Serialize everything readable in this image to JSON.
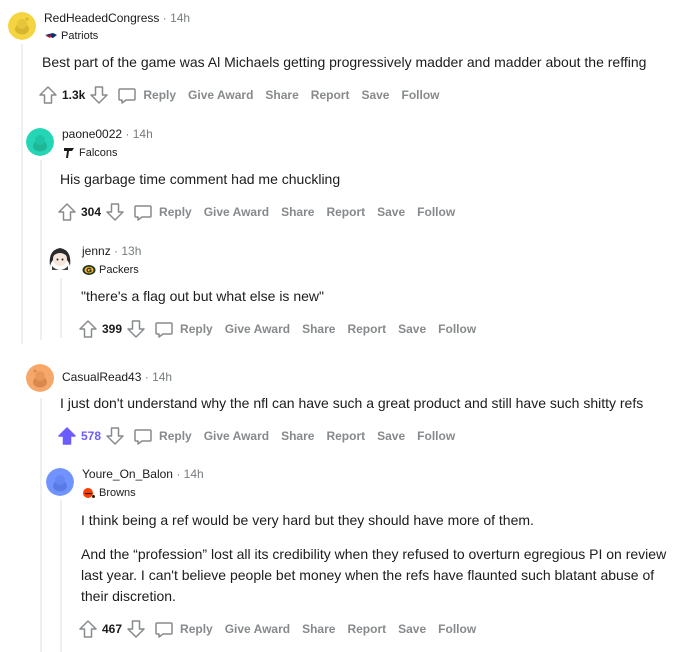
{
  "comments": [
    {
      "author": "RedHeadedCongress",
      "time": "· 14h",
      "flair": "Patriots",
      "body": "Best part of the game was Al Michaels getting progressively madder and madder about the reffing",
      "score": "1.3k",
      "avatar_color": "#f5d442"
    },
    {
      "author": "paone0022",
      "time": "· 14h",
      "flair": "Falcons",
      "body": "His garbage time comment had me chuckling",
      "score": "304",
      "avatar_color": "#24d6b5"
    },
    {
      "author": "jennz",
      "time": "· 13h",
      "flair": "Packers",
      "body": "\"there's a flag out but what else is new\"",
      "score": "399",
      "avatar_color": "#ffffff"
    },
    {
      "author": "CasualRead43",
      "time": "· 14h",
      "flair": "",
      "body": "I just don't understand why the nfl can have such a great product and still have such shitty refs",
      "score": "578",
      "avatar_color": "#f6a86b"
    },
    {
      "author": "Youre_On_Balon",
      "time": "· 14h",
      "flair": "Browns",
      "body1": "I think being a ref would be very hard but they should have more of them.",
      "body2": "And the “profession” lost all its credibility when they refused to overturn egregious PI on review last year. I can't believe people bet money when the refs have flaunted such blatant abuse of their discretion.",
      "score": "467",
      "avatar_color": "#7193ff"
    }
  ],
  "actions": {
    "reply": "Reply",
    "give_award": "Give Award",
    "share": "Share",
    "report": "Report",
    "save": "Save",
    "follow": "Follow"
  },
  "colors": {
    "upvote_active": "#6a5cff",
    "muted": "#878a8c",
    "thread_line": "#edeff1"
  }
}
